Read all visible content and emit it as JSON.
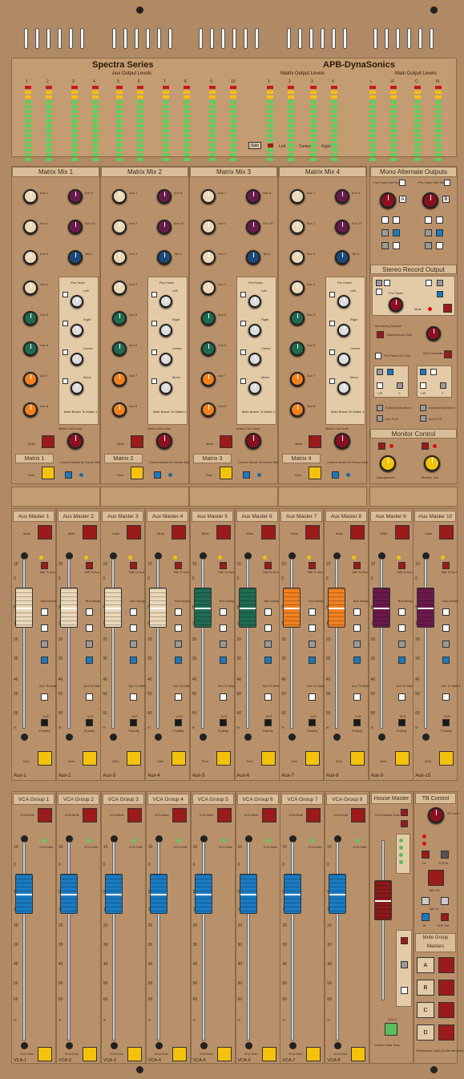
{
  "header": {
    "brand_left": "Spectra Series",
    "brand_right": "APB-DynaSonics",
    "aux_output_levels": "Aux Output Levels",
    "matrix_output_levels": "Matrix Output Levels",
    "main_output_levels": "Main Output Levels",
    "solo_label": "Solo",
    "left_label": "Left",
    "center_label": "Center",
    "right_label": "Right",
    "meter_numbers": [
      "1",
      "2",
      "3",
      "4",
      "5",
      "6",
      "7",
      "8",
      "9",
      "10",
      "1",
      "2",
      "3",
      "4",
      "L",
      "R",
      "C",
      "M"
    ]
  },
  "matrix_mixes": [
    {
      "title": "Matrix Mix 1",
      "label": "Matrix 1",
      "main_buses": "Main Buses To Matrix 1"
    },
    {
      "title": "Matrix Mix 2",
      "label": "Matrix 2",
      "main_buses": "Main Buses To Matrix 2"
    },
    {
      "title": "Matrix Mix 3",
      "label": "Matrix 3",
      "main_buses": "Main Buses To Matrix 3"
    },
    {
      "title": "Matrix Mix 4",
      "label": "Matrix 4",
      "main_buses": "Main Buses To Matrix 4"
    }
  ],
  "matrix_common": {
    "aux_knobs": [
      "Aux 1",
      "Aux 2",
      "Aux 3",
      "Aux 4",
      "Aux 5",
      "Aux 6",
      "Aux 7",
      "Aux 8"
    ],
    "right_knobs": [
      "Aux 9",
      "Aux 10",
      "Tal In"
    ],
    "pre_fader": "Pre-Fader",
    "left": "Left",
    "right": "Right",
    "center": "Center",
    "mono": "Mono",
    "matrix_out_level": "Matrix Out Level",
    "mute": "Mute",
    "solo": "Solo",
    "control_matrix": "Control Matrix w/ House Mstr"
  },
  "mono_alt": {
    "title": "Mono Alternate Outputs",
    "pre_fader_a": "Pre-Fader (Alt Source)",
    "pre_fader_b": "Pre-Fader (Alt Source)",
    "a": "A",
    "b": "B"
  },
  "stereo_record": {
    "title": "Stereo Record Output",
    "pre_fader": "Pre-Fader",
    "mute": "Mute"
  },
  "monitoring": {
    "monitoring_system": "Monitoring System",
    "headphones_only": "Headphones Only",
    "pre_fader_ab": "Pre-Fader A+C AB",
    "solo_override": "Solo Override",
    "lr": "L/R",
    "c": "C",
    "external": "External Monitor In",
    "aux_9_10": "Aux 9-10"
  },
  "monitor_control": {
    "title": "Monitor Control",
    "headphones": "Headphones",
    "monitor_out": "Monitor Out"
  },
  "aux_masters": [
    {
      "title": "Aux Master 1",
      "strip": "Aux-1",
      "color": "#ead8b8"
    },
    {
      "title": "Aux Master 2",
      "strip": "Aux-2",
      "color": "#ead8b8"
    },
    {
      "title": "Aux Master 3",
      "strip": "Aux-3",
      "color": "#ead8b8"
    },
    {
      "title": "Aux Master 4",
      "strip": "Aux-4",
      "color": "#ead8b8"
    },
    {
      "title": "Aux Master 5",
      "strip": "Aux-5",
      "color": "#1f6b52"
    },
    {
      "title": "Aux Master 6",
      "strip": "Aux-6",
      "color": "#1f6b52"
    },
    {
      "title": "Aux Master 7",
      "strip": "Aux-7",
      "color": "#f08020"
    },
    {
      "title": "Aux Master 8",
      "strip": "Aux-8",
      "color": "#f08020"
    },
    {
      "title": "Aux Master 9",
      "strip": "Aux-9",
      "color": "#6a1a4a"
    },
    {
      "title": "Aux Master 10",
      "strip": "Aux-10",
      "color": "#6a1a4a"
    }
  ],
  "aux_common": {
    "mute": "Mute",
    "solo": "Solo",
    "talk_to_aux": "Talk To Aux",
    "bus_assign": "Bus Assign",
    "aux_to_matrix": "Aux To Matrix",
    "xlr": "XLR",
    "polarity": "Polarity",
    "fader_scale": [
      "10",
      "0",
      "5",
      "10",
      "20",
      "30",
      "40",
      "50",
      "60",
      "∞"
    ]
  },
  "vca_groups": [
    {
      "title": "VCA Group 1",
      "strip": "VCA-1"
    },
    {
      "title": "VCA Group 2",
      "strip": "VCA-2"
    },
    {
      "title": "VCA Group 3",
      "strip": "VCA-3"
    },
    {
      "title": "VCA Group 4",
      "strip": "VCA-4"
    },
    {
      "title": "VCA Group 5",
      "strip": "VCA-5"
    },
    {
      "title": "VCA Group 6",
      "strip": "VCA-6"
    },
    {
      "title": "VCA Group 7",
      "strip": "VCA-7"
    },
    {
      "title": "VCA Group 8",
      "strip": "VCA-8"
    }
  ],
  "vca_common": {
    "mute": "VCA Mute",
    "solo": "VCA Solo",
    "safe": "VCA Safe"
  },
  "house_master": {
    "title": "House Master",
    "matrix_master": "VCA Master Gain",
    "solo": "SOLO",
    "active_clear": "Active Clear Solo"
  },
  "tb_control": {
    "title": "TB Control",
    "tb_level": "TB Level",
    "int": "Int",
    "xlr_in": "XLR In",
    "talk_on": "Talk On",
    "talk_to": "Talk To",
    "m": "M",
    "xlr_out": "XLR Out"
  },
  "mute_group_masters": {
    "title": "Mute Group Masters",
    "groups": [
      "A",
      "B",
      "C",
      "D"
    ],
    "footer": "Headphone Jack (Under Armrest)"
  }
}
